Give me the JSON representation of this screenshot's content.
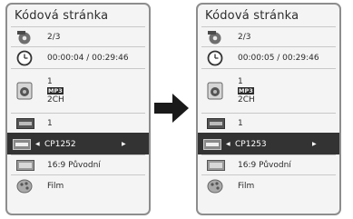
{
  "panels": [
    {
      "title": "Kódová stránka",
      "title_row": "2/3",
      "time": "00:00:04 / 00:29:46",
      "audio": {
        "line1": "1",
        "codec": "MP3",
        "channels": "2CH"
      },
      "subtitle": "1",
      "codepage": "CP1252",
      "aspect": "16:9 Původní",
      "mode": "Film"
    },
    {
      "title": "Kódová stránka",
      "title_row": "2/3",
      "time": "00:00:05 / 00:29:46",
      "audio": {
        "line1": "1",
        "codec": "MP3",
        "channels": "2CH"
      },
      "subtitle": "1",
      "codepage": "CP1253",
      "aspect": "16:9 Původní",
      "mode": "Film"
    }
  ],
  "icons": {
    "title": "disc-title-icon",
    "time": "clock-icon",
    "audio": "speaker-icon",
    "subtitle": "abc-subtitle-icon",
    "codepage": "abc-codepage-icon",
    "aspect": "aspect-ratio-icon",
    "mode": "picture-mode-icon",
    "arrow": "right-arrow-icon"
  },
  "colors": {
    "panel_bg": "#f4f4f4",
    "border": "#8d8d8d",
    "selected_bg": "#333333"
  }
}
